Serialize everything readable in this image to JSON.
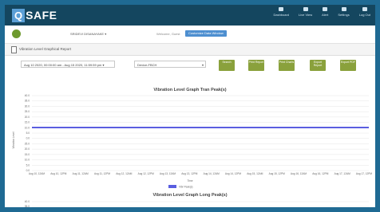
{
  "app": {
    "logo_box": "Q",
    "logo_rest": "SAFE"
  },
  "nav": [
    {
      "label": "Dashboard",
      "icon": "dashboard-icon"
    },
    {
      "label": "Live View",
      "icon": "monitor-icon"
    },
    {
      "label": "Alert",
      "icon": "bell-icon"
    },
    {
      "label": "Settings",
      "icon": "gear-icon"
    },
    {
      "label": "Log Out",
      "icon": "logout-icon"
    }
  ],
  "user": {
    "name": "SRIDEVI DISANAYAKE ▾",
    "welcome": "Welcome, Guest",
    "button": "Customize Data Window"
  },
  "panel": {
    "title": "Vibration Level Graphical Report"
  },
  "filters": {
    "date_range": "Aug 10 2020, 00:00:00 am - Aug 15 2020, 11:59:59 pm ▾",
    "device_select": "Device-FBCH"
  },
  "actions": [
    {
      "label": "Search"
    },
    {
      "label": "Print Report"
    },
    {
      "label": "Print Charts"
    },
    {
      "label": "Export Report"
    },
    {
      "label": "Export PDF"
    }
  ],
  "chart_data": [
    {
      "type": "line",
      "title": "Vibration Level Graph Tran Peak(s)",
      "xlabel": "Time",
      "ylabel": "Vibration Level",
      "x": [
        "Aug 10, 12AM",
        "Aug 10, 12PM",
        "Aug 11, 12AM",
        "Aug 11, 12PM",
        "Aug 12, 12AM",
        "Aug 12, 12PM",
        "Aug 13, 12AM",
        "Aug 13, 12PM",
        "Aug 14, 12AM",
        "Aug 14, 12PM",
        "Aug 15, 12AM",
        "Aug 15, 12PM",
        "Aug 16, 12AM",
        "Aug 16, 12PM",
        "Aug 17, 12AM",
        "Aug 17, 12PM"
      ],
      "yticks": [
        40.0,
        35.0,
        30.0,
        25.0,
        20.0,
        15.0,
        10.0,
        5.0,
        0.0,
        25.0,
        20.0,
        15.0,
        10.0,
        5.0,
        0.0
      ],
      "series": [
        {
          "name": "Vibr Peak(s)",
          "color": "#5a5ee0",
          "values": [
            23,
            23,
            23,
            23,
            23,
            23,
            23,
            23,
            23,
            23,
            23,
            23,
            23,
            23,
            23,
            23
          ]
        }
      ],
      "ylim": [
        0,
        40
      ],
      "grid": true,
      "legend": "bottom"
    },
    {
      "type": "line",
      "title": "Vibration Level Graph Long Peak(s)",
      "yticks": [
        40.0,
        35.0
      ]
    }
  ]
}
